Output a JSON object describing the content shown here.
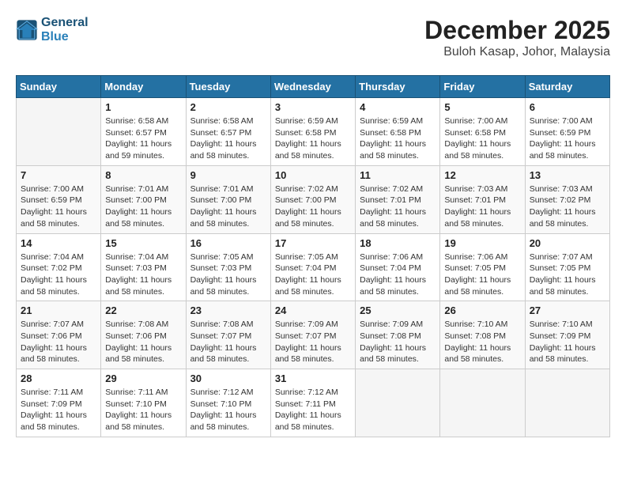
{
  "header": {
    "logo_line1": "General",
    "logo_line2": "Blue",
    "month_year": "December 2025",
    "location": "Buloh Kasap, Johor, Malaysia"
  },
  "weekdays": [
    "Sunday",
    "Monday",
    "Tuesday",
    "Wednesday",
    "Thursday",
    "Friday",
    "Saturday"
  ],
  "weeks": [
    [
      {
        "day": "",
        "info": ""
      },
      {
        "day": "1",
        "info": "Sunrise: 6:58 AM\nSunset: 6:57 PM\nDaylight: 11 hours\nand 59 minutes."
      },
      {
        "day": "2",
        "info": "Sunrise: 6:58 AM\nSunset: 6:57 PM\nDaylight: 11 hours\nand 58 minutes."
      },
      {
        "day": "3",
        "info": "Sunrise: 6:59 AM\nSunset: 6:58 PM\nDaylight: 11 hours\nand 58 minutes."
      },
      {
        "day": "4",
        "info": "Sunrise: 6:59 AM\nSunset: 6:58 PM\nDaylight: 11 hours\nand 58 minutes."
      },
      {
        "day": "5",
        "info": "Sunrise: 7:00 AM\nSunset: 6:58 PM\nDaylight: 11 hours\nand 58 minutes."
      },
      {
        "day": "6",
        "info": "Sunrise: 7:00 AM\nSunset: 6:59 PM\nDaylight: 11 hours\nand 58 minutes."
      }
    ],
    [
      {
        "day": "7",
        "info": "Sunrise: 7:00 AM\nSunset: 6:59 PM\nDaylight: 11 hours\nand 58 minutes."
      },
      {
        "day": "8",
        "info": "Sunrise: 7:01 AM\nSunset: 7:00 PM\nDaylight: 11 hours\nand 58 minutes."
      },
      {
        "day": "9",
        "info": "Sunrise: 7:01 AM\nSunset: 7:00 PM\nDaylight: 11 hours\nand 58 minutes."
      },
      {
        "day": "10",
        "info": "Sunrise: 7:02 AM\nSunset: 7:00 PM\nDaylight: 11 hours\nand 58 minutes."
      },
      {
        "day": "11",
        "info": "Sunrise: 7:02 AM\nSunset: 7:01 PM\nDaylight: 11 hours\nand 58 minutes."
      },
      {
        "day": "12",
        "info": "Sunrise: 7:03 AM\nSunset: 7:01 PM\nDaylight: 11 hours\nand 58 minutes."
      },
      {
        "day": "13",
        "info": "Sunrise: 7:03 AM\nSunset: 7:02 PM\nDaylight: 11 hours\nand 58 minutes."
      }
    ],
    [
      {
        "day": "14",
        "info": "Sunrise: 7:04 AM\nSunset: 7:02 PM\nDaylight: 11 hours\nand 58 minutes."
      },
      {
        "day": "15",
        "info": "Sunrise: 7:04 AM\nSunset: 7:03 PM\nDaylight: 11 hours\nand 58 minutes."
      },
      {
        "day": "16",
        "info": "Sunrise: 7:05 AM\nSunset: 7:03 PM\nDaylight: 11 hours\nand 58 minutes."
      },
      {
        "day": "17",
        "info": "Sunrise: 7:05 AM\nSunset: 7:04 PM\nDaylight: 11 hours\nand 58 minutes."
      },
      {
        "day": "18",
        "info": "Sunrise: 7:06 AM\nSunset: 7:04 PM\nDaylight: 11 hours\nand 58 minutes."
      },
      {
        "day": "19",
        "info": "Sunrise: 7:06 AM\nSunset: 7:05 PM\nDaylight: 11 hours\nand 58 minutes."
      },
      {
        "day": "20",
        "info": "Sunrise: 7:07 AM\nSunset: 7:05 PM\nDaylight: 11 hours\nand 58 minutes."
      }
    ],
    [
      {
        "day": "21",
        "info": "Sunrise: 7:07 AM\nSunset: 7:06 PM\nDaylight: 11 hours\nand 58 minutes."
      },
      {
        "day": "22",
        "info": "Sunrise: 7:08 AM\nSunset: 7:06 PM\nDaylight: 11 hours\nand 58 minutes."
      },
      {
        "day": "23",
        "info": "Sunrise: 7:08 AM\nSunset: 7:07 PM\nDaylight: 11 hours\nand 58 minutes."
      },
      {
        "day": "24",
        "info": "Sunrise: 7:09 AM\nSunset: 7:07 PM\nDaylight: 11 hours\nand 58 minutes."
      },
      {
        "day": "25",
        "info": "Sunrise: 7:09 AM\nSunset: 7:08 PM\nDaylight: 11 hours\nand 58 minutes."
      },
      {
        "day": "26",
        "info": "Sunrise: 7:10 AM\nSunset: 7:08 PM\nDaylight: 11 hours\nand 58 minutes."
      },
      {
        "day": "27",
        "info": "Sunrise: 7:10 AM\nSunset: 7:09 PM\nDaylight: 11 hours\nand 58 minutes."
      }
    ],
    [
      {
        "day": "28",
        "info": "Sunrise: 7:11 AM\nSunset: 7:09 PM\nDaylight: 11 hours\nand 58 minutes."
      },
      {
        "day": "29",
        "info": "Sunrise: 7:11 AM\nSunset: 7:10 PM\nDaylight: 11 hours\nand 58 minutes."
      },
      {
        "day": "30",
        "info": "Sunrise: 7:12 AM\nSunset: 7:10 PM\nDaylight: 11 hours\nand 58 minutes."
      },
      {
        "day": "31",
        "info": "Sunrise: 7:12 AM\nSunset: 7:11 PM\nDaylight: 11 hours\nand 58 minutes."
      },
      {
        "day": "",
        "info": ""
      },
      {
        "day": "",
        "info": ""
      },
      {
        "day": "",
        "info": ""
      }
    ]
  ]
}
